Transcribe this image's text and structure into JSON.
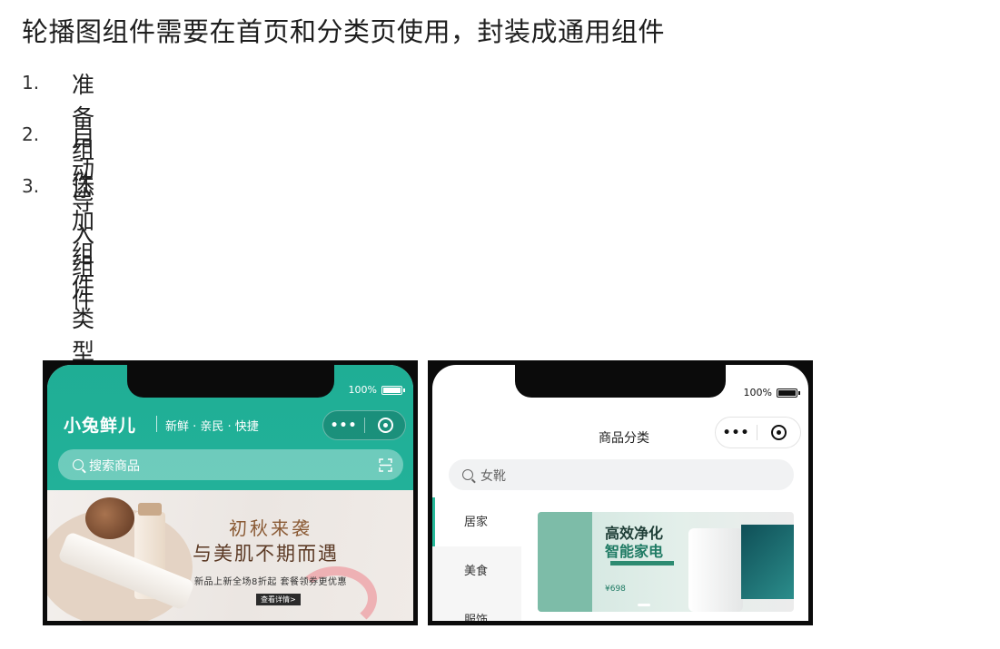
{
  "slide": {
    "title": "轮播图组件需要在首页和分类页使用，封装成通用组件",
    "steps": [
      {
        "num": "1.",
        "text": "准备组件"
      },
      {
        "num": "2.",
        "text": "自动导入组件"
      },
      {
        "num": "3.",
        "text": "添加组件类型声明"
      }
    ]
  },
  "home_screen": {
    "battery": "100%",
    "brand": "小兔鲜儿",
    "slogan": "新鲜 · 亲民 · 快捷",
    "capsule_dots": "•••",
    "search_placeholder": "搜索商品",
    "banner": {
      "headline": "初秋来袭",
      "subline": "与美肌不期而遇",
      "promo": "新品上新全场8折起  套餐领券更优惠",
      "cta": "查看详情>"
    },
    "theme_color": "#27ba9b"
  },
  "category_screen": {
    "battery": "100%",
    "title": "商品分类",
    "capsule_dots": "•••",
    "search_placeholder": "女靴",
    "categories": [
      "居家",
      "美食",
      "服饰"
    ],
    "active_category": "居家",
    "banner": {
      "line1": "高效净化",
      "line2": "智能家电",
      "price": "¥698"
    }
  }
}
